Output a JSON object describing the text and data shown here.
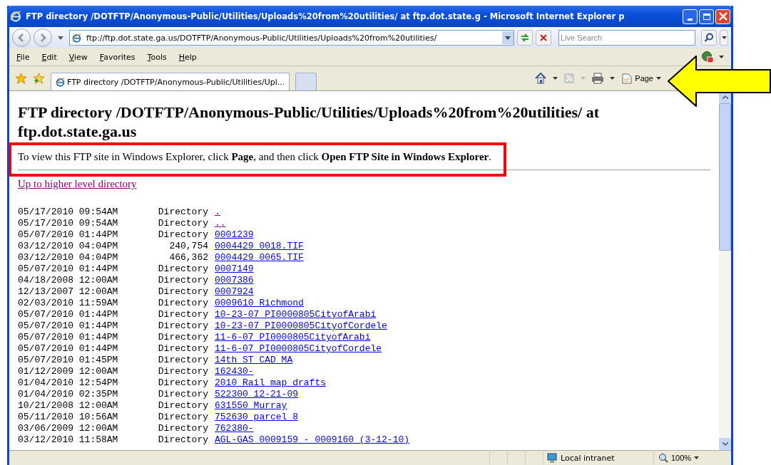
{
  "window": {
    "title": "FTP directory /DOTFTP/Anonymous-Public/Utilities/Uploads%20from%20utilities/ at ftp.dot.state.g - Microsoft Internet Explorer p"
  },
  "address_bar": {
    "value": "ftp://ftp.dot.state.ga.us/DOTFTP/Anonymous-Public/Utilities/Uploads%20from%20utilities/"
  },
  "search": {
    "placeholder": "Live Search"
  },
  "menu": [
    "File",
    "Edit",
    "View",
    "Favorites",
    "Tools",
    "Help"
  ],
  "tabs": [
    {
      "label": "FTP directory /DOTFTP/Anonymous-Public/Utilities/Upl...",
      "selected": true
    }
  ],
  "command_bar": {
    "page_label": "Page"
  },
  "page": {
    "heading": "FTP directory /DOTFTP/Anonymous-Public/Utilities/Uploads%20from%20utilities/ at ftp.dot.state.ga.us",
    "instruction": "To view this FTP site in Windows Explorer, click **Page**, and then click **Open FTP Site in Windows Explorer**.",
    "up_link": {
      "label": "Up to higher level directory",
      "visited": true
    },
    "rows": [
      {
        "modified": "05/17/2010 09:54AM",
        "size": "Directory",
        "name": ".",
        "visited": true
      },
      {
        "modified": "05/17/2010 09:54AM",
        "size": "Directory",
        "name": "..",
        "visited": true
      },
      {
        "modified": "05/07/2010 01:44PM",
        "size": "Directory",
        "name": "0001239",
        "visited": false
      },
      {
        "modified": "03/12/2010 04:04PM",
        "size": "240,754",
        "name": "0004429_0018.TIF",
        "visited": false
      },
      {
        "modified": "03/12/2010 04:04PM",
        "size": "466,362",
        "name": "0004429_0065.TIF",
        "visited": false
      },
      {
        "modified": "05/07/2010 01:44PM",
        "size": "Directory",
        "name": "0007149",
        "visited": false
      },
      {
        "modified": "04/18/2008 12:00AM",
        "size": "Directory",
        "name": "0007386",
        "visited": false
      },
      {
        "modified": "12/13/2007 12:00AM",
        "size": "Directory",
        "name": "0007924",
        "visited": false
      },
      {
        "modified": "02/03/2010 11:59AM",
        "size": "Directory",
        "name": "0009610 Richmond",
        "visited": false
      },
      {
        "modified": "05/07/2010 01:44PM",
        "size": "Directory",
        "name": "10-23-07_PI0000805CityofArabi",
        "visited": false
      },
      {
        "modified": "05/07/2010 01:44PM",
        "size": "Directory",
        "name": "10-23-07_PI0000805CityofCordele",
        "visited": false
      },
      {
        "modified": "05/07/2010 01:44PM",
        "size": "Directory",
        "name": "11-6-07_PI0000805CityofArabi",
        "visited": false
      },
      {
        "modified": "05/07/2010 01:44PM",
        "size": "Directory",
        "name": "11-6-07_PI0000805CityofCordele",
        "visited": false
      },
      {
        "modified": "05/07/2010 01:45PM",
        "size": "Directory",
        "name": "14th ST CAD_MA",
        "visited": false
      },
      {
        "modified": "01/12/2009 12:00AM",
        "size": "Directory",
        "name": "162430-",
        "visited": false
      },
      {
        "modified": "01/04/2010 12:54PM",
        "size": "Directory",
        "name": "2010 Rail map drafts",
        "visited": false
      },
      {
        "modified": "01/04/2010 02:35PM",
        "size": "Directory",
        "name": "522300 12-21-09",
        "visited": false
      },
      {
        "modified": "10/21/2008 12:00AM",
        "size": "Directory",
        "name": "631550 Murray",
        "visited": false
      },
      {
        "modified": "05/11/2010 10:56AM",
        "size": "Directory",
        "name": "752630 parcel 8",
        "visited": false
      },
      {
        "modified": "03/06/2009 12:00AM",
        "size": "Directory",
        "name": "762380-",
        "visited": false
      },
      {
        "modified": "03/12/2010 11:58AM",
        "size": "Directory",
        "name": "AGL-GAS 0009159 - 0009160 (3-12-10)",
        "visited": false
      }
    ]
  },
  "status_bar": {
    "zone": "Local intranet",
    "zoom": "100%"
  }
}
